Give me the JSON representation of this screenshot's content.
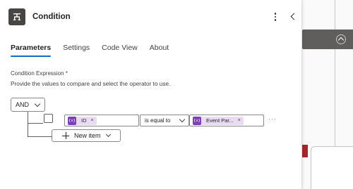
{
  "panel": {
    "title": "Condition",
    "icon": "condition-icon",
    "more_icon": "more-vertical-icon",
    "collapse_icon": "chevron-left-icon"
  },
  "tabs": [
    {
      "label": "Parameters",
      "active": true
    },
    {
      "label": "Settings",
      "active": false
    },
    {
      "label": "Code View",
      "active": false
    },
    {
      "label": "About",
      "active": false
    }
  ],
  "condition": {
    "label": "Condition Expression *",
    "help": "Provide the values to compare and select the operator to use.",
    "group_operator": "AND",
    "row": {
      "left_token": {
        "icon_text": "{x}",
        "label": "ID",
        "remove": "×"
      },
      "operator": "is equal to",
      "right_token": {
        "icon_text": "{x}",
        "label": "Event Par...",
        "remove": "×"
      },
      "more": "···"
    },
    "new_item_label": "New item"
  },
  "colors": {
    "accent": "#0f6cbd",
    "token_bg": "#e8dbf3",
    "token_icon": "#7e3eb6",
    "header_icon_bg": "#484644",
    "canvas_card": "#605e5c",
    "error_marker": "#a4262c"
  }
}
